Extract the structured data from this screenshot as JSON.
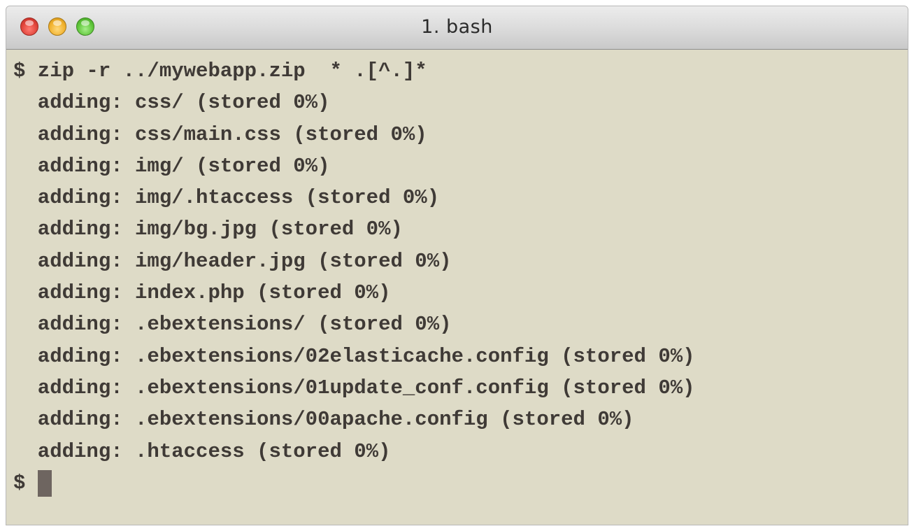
{
  "window": {
    "title": "1. bash"
  },
  "terminal": {
    "lines": [
      "$ zip -r ../mywebapp.zip  * .[^.]*",
      "  adding: css/ (stored 0%)",
      "  adding: css/main.css (stored 0%)",
      "  adding: img/ (stored 0%)",
      "  adding: img/.htaccess (stored 0%)",
      "  adding: img/bg.jpg (stored 0%)",
      "  adding: img/header.jpg (stored 0%)",
      "  adding: index.php (stored 0%)",
      "  adding: .ebextensions/ (stored 0%)",
      "  adding: .ebextensions/02elasticache.config (stored 0%)",
      "  adding: .ebextensions/01update_conf.config (stored 0%)",
      "  adding: .ebextensions/00apache.config (stored 0%)",
      "  adding: .htaccess (stored 0%)"
    ],
    "prompt": "$"
  },
  "colors": {
    "background": "#dedbc7",
    "text": "#3f3a36",
    "cursor": "#6e6560"
  }
}
